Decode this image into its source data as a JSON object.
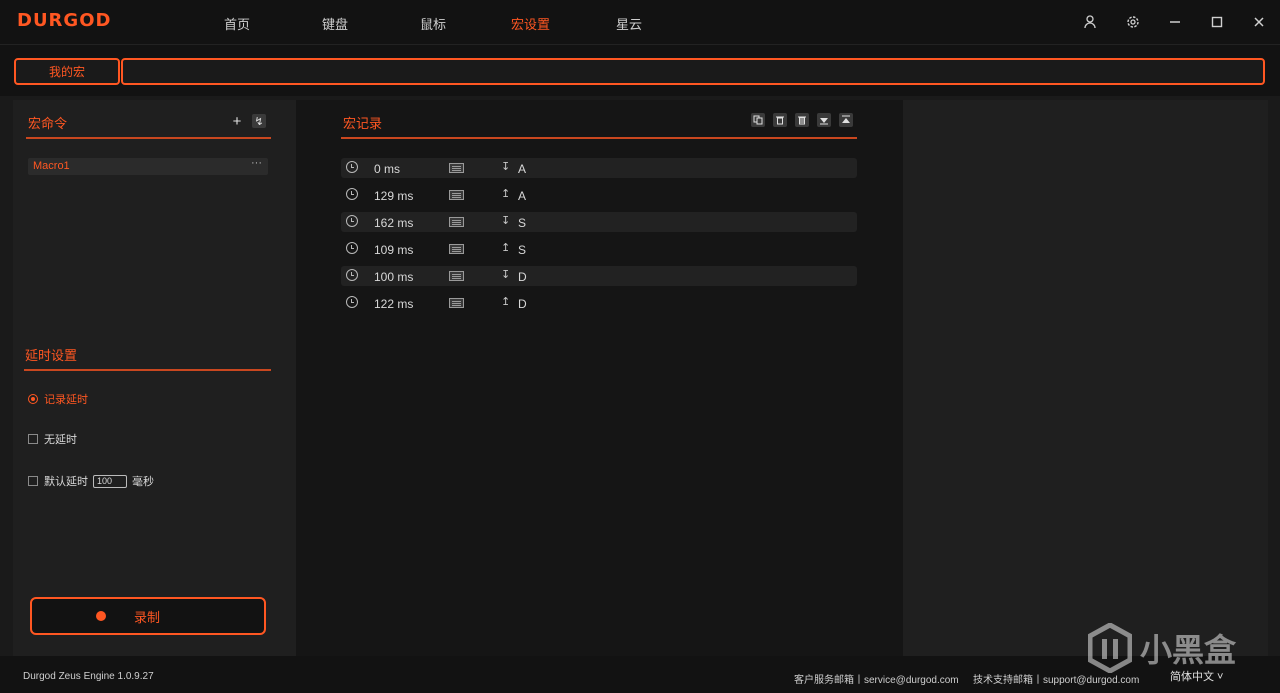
{
  "app": {
    "logo": "DURGOD",
    "nav": [
      "首页",
      "键盘",
      "鼠标",
      "宏设置",
      "星云"
    ],
    "active_nav": "宏设置"
  },
  "tabs": {
    "my_macro": "我的宏"
  },
  "left": {
    "macro_section_title": "宏命令",
    "add_icon": "+",
    "import_icon": "↯",
    "macros": [
      {
        "name": "Macro1",
        "more": "···"
      }
    ],
    "delay_section_title": "延时设置",
    "option_record_delay": "记录延时",
    "option_no_delay": "无延时",
    "option_default_delay": "默认延时",
    "default_delay_value": "100",
    "default_delay_unit": "毫秒",
    "record_button": "录制"
  },
  "mid": {
    "title": "宏记录",
    "records": [
      {
        "time": "0 ms",
        "action": "↧",
        "key": "A"
      },
      {
        "time": "129 ms",
        "action": "↥",
        "key": "A"
      },
      {
        "time": "162 ms",
        "action": "↧",
        "key": "S"
      },
      {
        "time": "109 ms",
        "action": "↥",
        "key": "S"
      },
      {
        "time": "100 ms",
        "action": "↧",
        "key": "D"
      },
      {
        "time": "122 ms",
        "action": "↥",
        "key": "D"
      }
    ]
  },
  "footer": {
    "version": "Durgod Zeus Engine 1.0.9.27",
    "service": "客户服务邮箱丨service@durgod.com",
    "support": "技术支持邮箱丨support@durgod.com",
    "language": "简体中文 ˅"
  },
  "watermark": "小黑盒",
  "colors": {
    "accent": "#ff5722",
    "background": "#1a1a1a",
    "panel": "#1f1f1f"
  }
}
